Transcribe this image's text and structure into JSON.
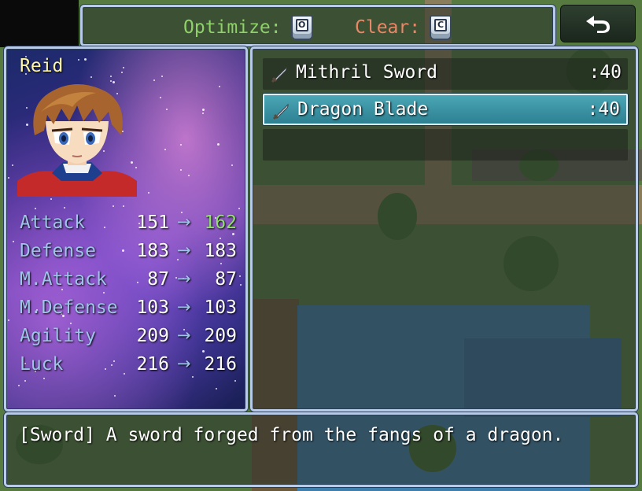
{
  "commands": {
    "optimize": {
      "label": "Optimize:",
      "key": "O",
      "color": "#8fd06a"
    },
    "clear": {
      "label": "Clear:",
      "key": "C",
      "color": "#ea8766"
    }
  },
  "back_button": {
    "icon": "return-arrow-icon"
  },
  "actor": {
    "name": "Reid",
    "params": [
      {
        "name": "Attack",
        "old": "151",
        "new": "162",
        "change": "up"
      },
      {
        "name": "Defense",
        "old": "183",
        "new": "183",
        "change": "same"
      },
      {
        "name": "M.Attack",
        "old": "87",
        "new": "87",
        "change": "same"
      },
      {
        "name": "M.Defense",
        "old": "103",
        "new": "103",
        "change": "same"
      },
      {
        "name": "Agility",
        "old": "209",
        "new": "209",
        "change": "same"
      },
      {
        "name": "Luck",
        "old": "216",
        "new": "216",
        "change": "same"
      }
    ],
    "arrow": "→"
  },
  "items": [
    {
      "icon": "sword-icon",
      "name": "Mithril Sword",
      "count": ":40",
      "selected": false
    },
    {
      "icon": "sword-icon",
      "name": "Dragon Blade",
      "count": ":40",
      "selected": true
    },
    {
      "icon": "",
      "name": "",
      "count": "",
      "selected": false
    }
  ],
  "help": {
    "text": "[Sword] A sword forged from the fangs of a dragon."
  },
  "colors": {
    "param_up": "#8fe06a",
    "param_same": "#ffffff",
    "system": "#9ec4e8",
    "actor_name": "#fff7a6"
  }
}
